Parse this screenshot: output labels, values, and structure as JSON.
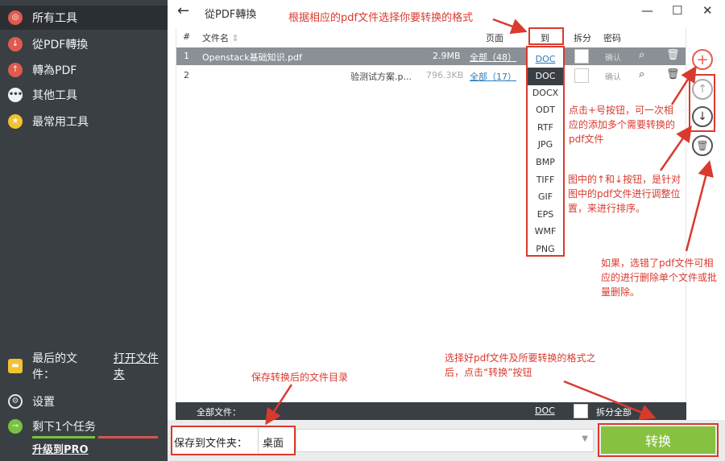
{
  "sidebar": {
    "items": [
      {
        "label": "所有工具",
        "icon": "target-icon"
      },
      {
        "label": "從PDF轉換",
        "icon": "arrow-down-icon"
      },
      {
        "label": "轉為PDF",
        "icon": "arrow-up-icon"
      },
      {
        "label": "其他工具",
        "icon": "more-icon"
      },
      {
        "label": "最常用工具",
        "icon": "star-icon"
      }
    ],
    "recent_files": {
      "label": "最后的文件：",
      "link": "打开文件夹",
      "icon": "folder-icon"
    },
    "settings": {
      "label": "设置",
      "icon": "gear-icon"
    },
    "tasks": {
      "label": "剩下1个任务",
      "icon": "key-icon"
    },
    "upgrade": "升级到PRO"
  },
  "titlebar": {
    "back": "←",
    "title": "從PDF轉換",
    "minimize": "—",
    "maximize": "☐",
    "close": "✕"
  },
  "table": {
    "headers": {
      "num": "#",
      "filename": "文件名",
      "pages": "页面",
      "to": "到",
      "split": "拆分",
      "password": "密码"
    },
    "rows": [
      {
        "num": "1",
        "filename": "Openstack基础知识.pdf",
        "size": "2.9MB",
        "pages": "全部（48）",
        "format": "DOC",
        "unlock": "确认"
      },
      {
        "num": "2",
        "filename": "验测试方案.p...",
        "size": "796.3KB",
        "pages": "全部（17）",
        "format": "DOC",
        "unlock": "确认"
      }
    ]
  },
  "format_options": [
    "DOC",
    "DOCX",
    "ODT",
    "RTF",
    "JPG",
    "BMP",
    "TIFF",
    "GIF",
    "EPS",
    "WMF",
    "PNG"
  ],
  "footer": {
    "all_files": "全部文件：",
    "format": "DOC",
    "split_all": "拆分全部"
  },
  "bottom": {
    "save_label": "保存到文件夹：",
    "save_value": "桌面",
    "convert": "转换"
  },
  "side_buttons": {
    "add": "+",
    "up": "↑",
    "down": "↓",
    "delete": "🗑"
  },
  "annotations": {
    "format": "根据相应的pdf文件选择你要转换的格式",
    "add": "点击+号按钮，可一次相应的添加多个需要转换的pdf文件",
    "order": "图中的↑和↓按钮，是针对图中的pdf文件进行调整位置，来进行排序。",
    "delete": "如果，选错了pdf文件可相应的进行删除单个文件或批量删除。",
    "save": "保存转换后的文件目录",
    "convert": "选择好pdf文件及所要转换的格式之后，点击“转换”按钮"
  },
  "colors": {
    "sidebar": "#3a3f44",
    "accent_red": "#d93a2e",
    "convert_green": "#86c240",
    "selected_row": "#8b9096"
  }
}
